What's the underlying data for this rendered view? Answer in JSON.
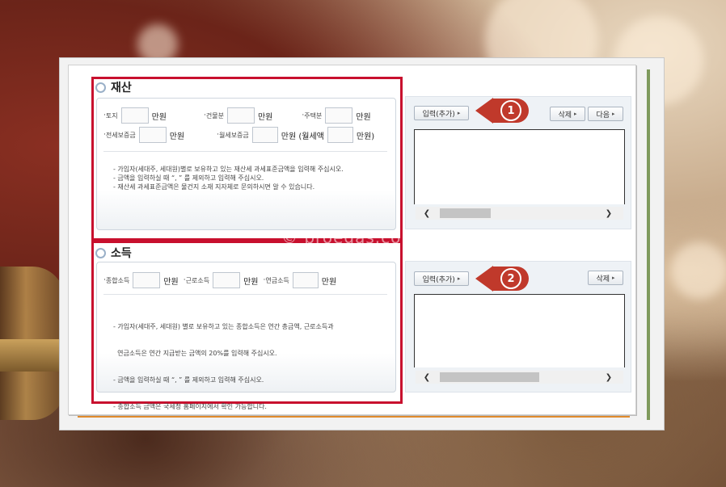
{
  "property": {
    "title": "재산",
    "row1": {
      "land_label": "토지",
      "unit1": "만원",
      "building_label": "건물분",
      "unit2": "만원",
      "house_label": "주택분",
      "unit3": "만원"
    },
    "row2": {
      "jeonse_label": "전세보증금",
      "unit4": "만원",
      "monthly_label": "월세보증금",
      "unit5": "만원 (월세액",
      "unit6": "만원)"
    },
    "notes": [
      "- 가입자(세대주, 세대원)별로 보유하고 있는 재산세 과세표준금액을 입력해 주십시오.",
      "- 금액을 입력하실 때 “, ” 를 제외하고 입력해 주십시오.",
      "- 재산세 과세표준금액은 물건지 소재 지자체로 문의하시면 알 수 있습니다."
    ],
    "buttons": {
      "add": "입력(추가)",
      "delete": "삭제",
      "next": "다음"
    },
    "callout": "1"
  },
  "income": {
    "title": "소득",
    "row1": {
      "total_label": "종합소득",
      "unit1": "만원",
      "earned_label": "근로소득",
      "unit2": "만원",
      "pension_label": "연금소득",
      "unit3": "만원"
    },
    "notes": [
      "- 가입자(세대주, 세대원) 별로 보유하고 있는 종합소득은 연간 총금액, 근로소득과",
      "  연금소득은 연간 지급받는 금액의 20%를 입력해 주십시오.",
      "- 금액을 입력하실 때 “, ” 를 제외하고 입력해 주십시오.",
      "- 종합소득 금액은 국세청 홈페이지에서 확인 가능합니다."
    ],
    "buttons": {
      "add": "입력(추가)",
      "delete": "삭제"
    },
    "callout": "2"
  },
  "watermark": "© proegas.com",
  "colors": {
    "highlight_red": "#c8102e",
    "callout_red": "#c0392b",
    "orange": "#e08a2c",
    "green": "#7f9a5c"
  }
}
